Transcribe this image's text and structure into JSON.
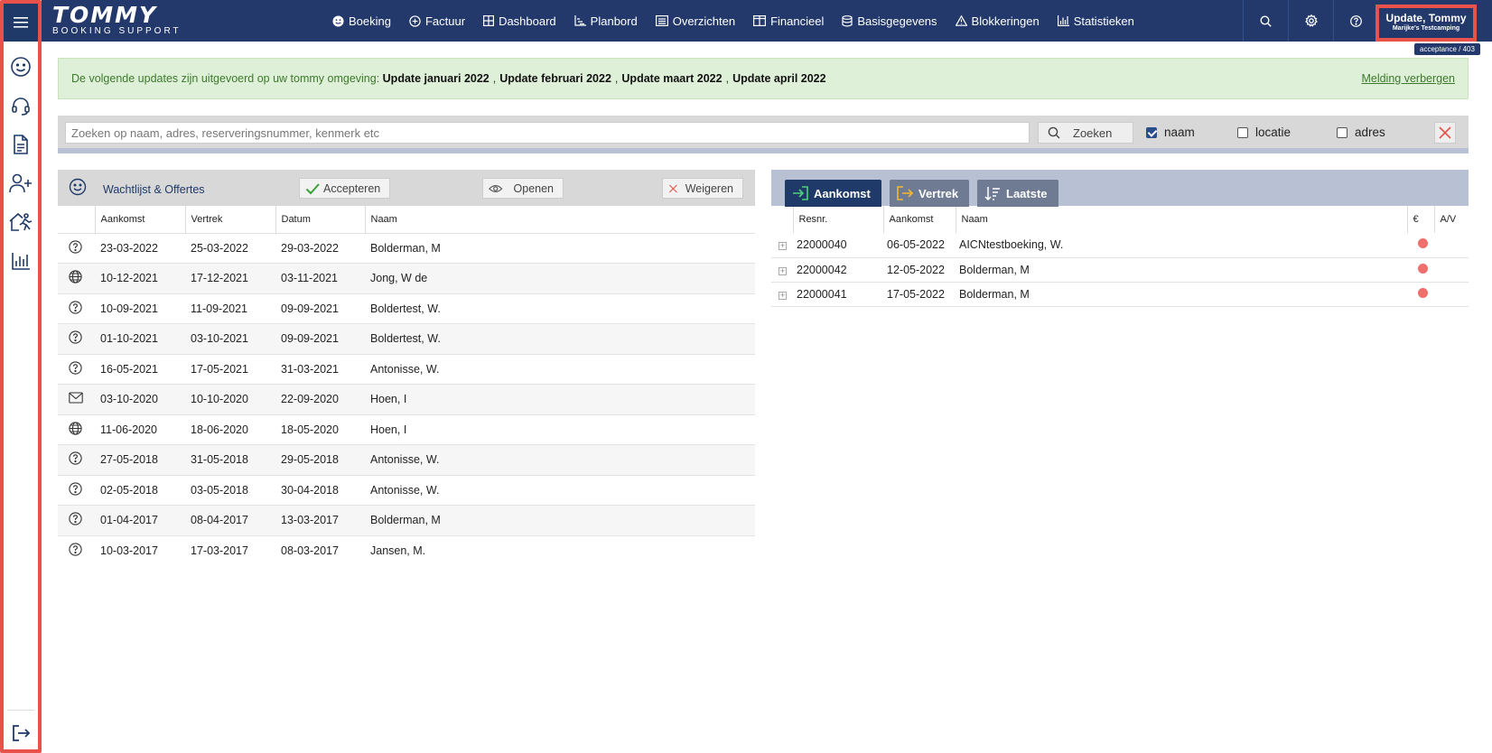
{
  "sidebar": {
    "items": [
      {
        "name": "menu-icon"
      },
      {
        "name": "smiley-icon"
      },
      {
        "name": "headset-icon"
      },
      {
        "name": "document-icon"
      },
      {
        "name": "add-user-icon"
      },
      {
        "name": "house-runner-icon"
      },
      {
        "name": "bar-chart-icon"
      },
      {
        "name": "logout-icon"
      }
    ]
  },
  "header": {
    "logo_main": "TOMMY",
    "logo_sub": "BOOKING SUPPORT",
    "nav": [
      {
        "label": "Boeking",
        "icon": "smiley-icon"
      },
      {
        "label": "Factuur",
        "icon": "plus-circle-icon"
      },
      {
        "label": "Dashboard",
        "icon": "grid-icon"
      },
      {
        "label": "Planbord",
        "icon": "chart-icon"
      },
      {
        "label": "Overzichten",
        "icon": "list-icon"
      },
      {
        "label": "Financieel",
        "icon": "columns-icon"
      },
      {
        "label": "Basisgegevens",
        "icon": "database-icon"
      },
      {
        "label": "Blokkeringen",
        "icon": "warning-icon"
      },
      {
        "label": "Statistieken",
        "icon": "bar-chart-icon"
      }
    ],
    "user_name": "Update, Tommy",
    "user_company": "Marijke's Testcamping",
    "env_badge": "acceptance / 403"
  },
  "notice": {
    "intro": "De volgende updates zijn uitgevoerd op uw tommy omgeving:",
    "updates": [
      "Update januari 2022",
      "Update februari 2022",
      "Update maart 2022",
      "Update april 2022"
    ],
    "separator": ",",
    "hide_label": "Melding verbergen"
  },
  "search": {
    "placeholder": "Zoeken op naam, adres, reserveringsnummer, kenmerk etc",
    "button_label": "Zoeken",
    "filters": [
      {
        "label": "naam",
        "checked": true
      },
      {
        "label": "locatie",
        "checked": false
      },
      {
        "label": "adres",
        "checked": false
      }
    ]
  },
  "waitlist": {
    "title": "Wachtlijst & Offertes",
    "accept_label": "Accepteren",
    "open_label": "Openen",
    "reject_label": "Weigeren",
    "columns": [
      "Aankomst",
      "Vertrek",
      "Datum",
      "Naam"
    ],
    "rows": [
      {
        "icon": "question-icon",
        "aankomst": "23-03-2022",
        "vertrek": "25-03-2022",
        "datum": "29-03-2022",
        "naam": "Bolderman, M"
      },
      {
        "icon": "globe-icon",
        "aankomst": "10-12-2021",
        "vertrek": "17-12-2021",
        "datum": "03-11-2021",
        "naam": "Jong, W de"
      },
      {
        "icon": "question-icon",
        "aankomst": "10-09-2021",
        "vertrek": "11-09-2021",
        "datum": "09-09-2021",
        "naam": "Boldertest, W."
      },
      {
        "icon": "question-icon",
        "aankomst": "01-10-2021",
        "vertrek": "03-10-2021",
        "datum": "09-09-2021",
        "naam": "Boldertest, W."
      },
      {
        "icon": "question-icon",
        "aankomst": "16-05-2021",
        "vertrek": "17-05-2021",
        "datum": "31-03-2021",
        "naam": "Antonisse, W."
      },
      {
        "icon": "mail-icon",
        "aankomst": "03-10-2020",
        "vertrek": "10-10-2020",
        "datum": "22-09-2020",
        "naam": "Hoen, I"
      },
      {
        "icon": "globe-icon",
        "aankomst": "11-06-2020",
        "vertrek": "18-06-2020",
        "datum": "18-05-2020",
        "naam": "Hoen, I"
      },
      {
        "icon": "question-icon",
        "aankomst": "27-05-2018",
        "vertrek": "31-05-2018",
        "datum": "29-05-2018",
        "naam": "Antonisse, W."
      },
      {
        "icon": "question-icon",
        "aankomst": "02-05-2018",
        "vertrek": "03-05-2018",
        "datum": "30-04-2018",
        "naam": "Antonisse, W."
      },
      {
        "icon": "question-icon",
        "aankomst": "01-04-2017",
        "vertrek": "08-04-2017",
        "datum": "13-03-2017",
        "naam": "Bolderman, M"
      },
      {
        "icon": "question-icon",
        "aankomst": "10-03-2017",
        "vertrek": "17-03-2017",
        "datum": "08-03-2017",
        "naam": "Jansen, M."
      }
    ]
  },
  "arrivals": {
    "tabs": [
      {
        "label": "Aankomst",
        "active": true,
        "icon": "sign-in-icon"
      },
      {
        "label": "Vertrek",
        "active": false,
        "icon": "sign-out-icon"
      },
      {
        "label": "Laatste",
        "active": false,
        "icon": "sort-icon"
      }
    ],
    "columns": [
      "Resnr.",
      "Aankomst",
      "Naam",
      "€",
      "A/V"
    ],
    "rows": [
      {
        "resnr": "22000040",
        "aankomst": "06-05-2022",
        "naam": "AICNtestboeking, W.",
        "status_color": "#ef6f6c"
      },
      {
        "resnr": "22000042",
        "aankomst": "12-05-2022",
        "naam": "Bolderman, M",
        "status_color": "#ef6f6c"
      },
      {
        "resnr": "22000041",
        "aankomst": "17-05-2022",
        "naam": "Bolderman, M",
        "status_color": "#ef6f6c"
      }
    ]
  },
  "colors": {
    "header_bg": "#23396b",
    "highlight_border": "#e8524a",
    "notice_bg": "#dff0d8",
    "active_tab": "#1f3a68"
  }
}
